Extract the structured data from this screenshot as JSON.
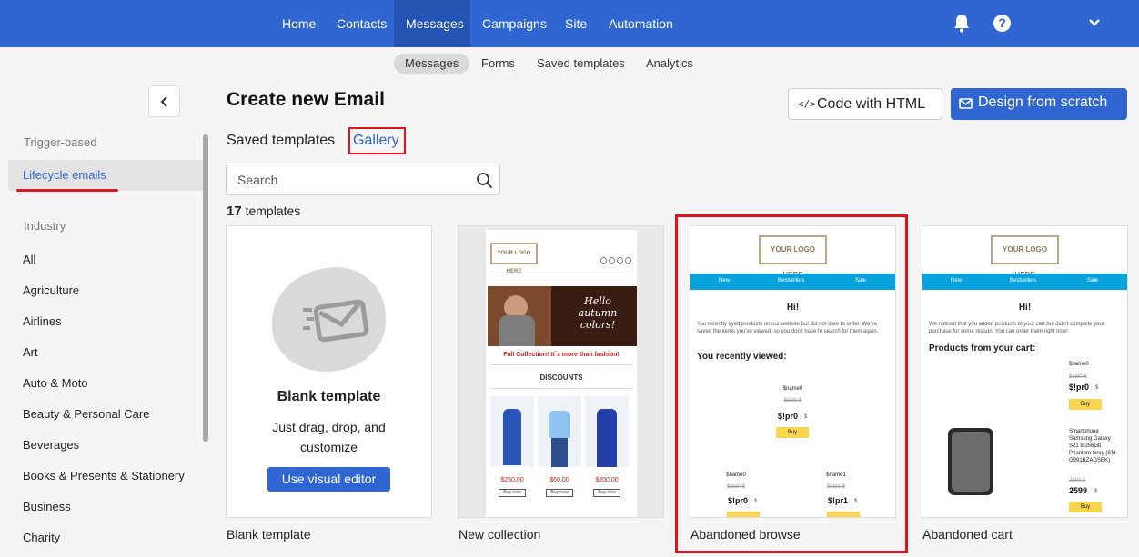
{
  "nav": {
    "items": [
      "Home",
      "Contacts",
      "Messages",
      "Campaigns",
      "Site",
      "Automation"
    ],
    "active": "Messages"
  },
  "subnav": {
    "items": [
      "Messages",
      "Forms",
      "Saved templates",
      "Analytics"
    ],
    "active": "Messages"
  },
  "sidebar": {
    "trigger_heading": "Trigger-based",
    "trigger_active": "Lifecycle emails",
    "industry_heading": "Industry",
    "industries": [
      "All",
      "Agriculture",
      "Airlines",
      "Art",
      "Auto & Moto",
      "Beauty & Personal Care",
      "Beverages",
      "Books & Presents & Stationery",
      "Business",
      "Charity"
    ]
  },
  "main": {
    "title": "Create new Email",
    "code_button": "Code with HTML",
    "code_icon": "</>",
    "scratch_button": "Design from scratch",
    "tabs": {
      "saved": "Saved templates",
      "gallery": "Gallery"
    },
    "search_placeholder": "Search",
    "count_number": "17",
    "count_label": "templates"
  },
  "cards": [
    {
      "label": "Blank template",
      "title": "Blank template",
      "description": "Just drag, drop, and customize",
      "button": "Use visual editor"
    },
    {
      "label": "New collection",
      "logo": "YOUR LOGO HERE",
      "banner": "Hello autumn colors!",
      "headline": "Fall Collection! It`s more than fashion!",
      "section": "DISCOUNTS",
      "prices": [
        "$250.00",
        "$60.00",
        "$200.00"
      ],
      "buy": "Buy now"
    },
    {
      "label": "Abandoned browse",
      "logo": "YOUR LOGO HERE",
      "menu": [
        "New",
        "Bestsellers",
        "Sale"
      ],
      "greeting": "Hi!",
      "body": "You recently eyed products on our website but did not dare to order. We've saved the items you've viewed, so you don't have to search for them again.",
      "heading": "You recently viewed:",
      "item_name": "$name0",
      "old_price": "$old0 $",
      "price": "$!pr0",
      "currency": "$",
      "buy": "Buy",
      "item_name2": "$name1",
      "old_price2": "$old1 $",
      "price2": "$!pr1"
    },
    {
      "label": "Abandoned cart",
      "logo": "YOUR LOGO HERE",
      "menu": [
        "New",
        "Bestsellers",
        "Sale"
      ],
      "greeting": "Hi!",
      "body": "We noticed that you added products to your cart but didn't complete your purchase for some reason. You can order them right now!",
      "heading": "Products from your cart:",
      "item_name": "$name0",
      "old_price": "$old0 $",
      "price": "$!pr0",
      "currency": "$",
      "buy": "Buy",
      "product": "Smartphone Samsung Galaxy S21 8/256Gb Phantom Grey (SM-G991BZAGSEK)",
      "product_old": "2800 $",
      "product_price": "2599"
    }
  ],
  "colors": {
    "brand": "#2f66d1",
    "highlight": "#e0141e",
    "menu_bar": "#08a2dd",
    "buy": "#f9d54f"
  }
}
